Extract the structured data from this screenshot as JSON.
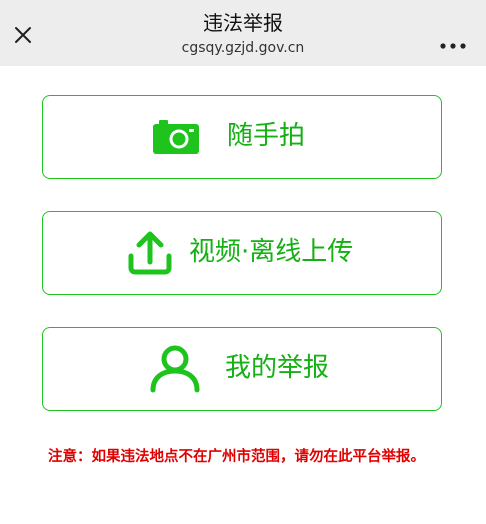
{
  "titlebar": {
    "title": "违法举报",
    "domain": "cgsqy.gzjd.gov.cn",
    "close_icon": "close-icon",
    "more_icon": "more-icon"
  },
  "actions": [
    {
      "label": "随手拍",
      "icon": "camera-icon"
    },
    {
      "label": "视频·离线上传",
      "icon": "upload-icon"
    },
    {
      "label": "我的举报",
      "icon": "user-icon"
    }
  ],
  "notice": {
    "text": "注意：如果违法地点不在广州市范围，请勿在此平台举报。"
  },
  "colors": {
    "accent": "#1ec31e",
    "notice": "#e00000",
    "titlebar_bg": "#ededed"
  }
}
